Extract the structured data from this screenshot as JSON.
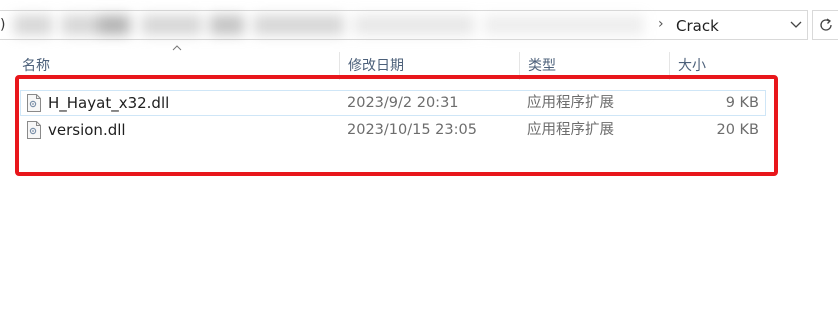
{
  "address_bar": {
    "left_glyph": ")",
    "separator": "›",
    "current_folder": "Crack",
    "dropdown_icon": "chevron-down-icon"
  },
  "refresh_icon": "refresh-icon",
  "columns": {
    "name": "名称",
    "date_modified": "修改日期",
    "type": "类型",
    "size": "大小"
  },
  "files": [
    {
      "name": "H_Hayat_x32.dll",
      "date_modified": "2023/9/2 20:31",
      "type": "应用程序扩展",
      "size": "9 KB",
      "icon": "dll-file-icon"
    },
    {
      "name": "version.dll",
      "date_modified": "2023/10/15 23:05",
      "type": "应用程序扩展",
      "size": "20 KB",
      "icon": "dll-file-icon"
    }
  ],
  "colors": {
    "highlight": "#e8161b",
    "selection_border": "#cfe6f7",
    "header_text": "#4c607a"
  }
}
